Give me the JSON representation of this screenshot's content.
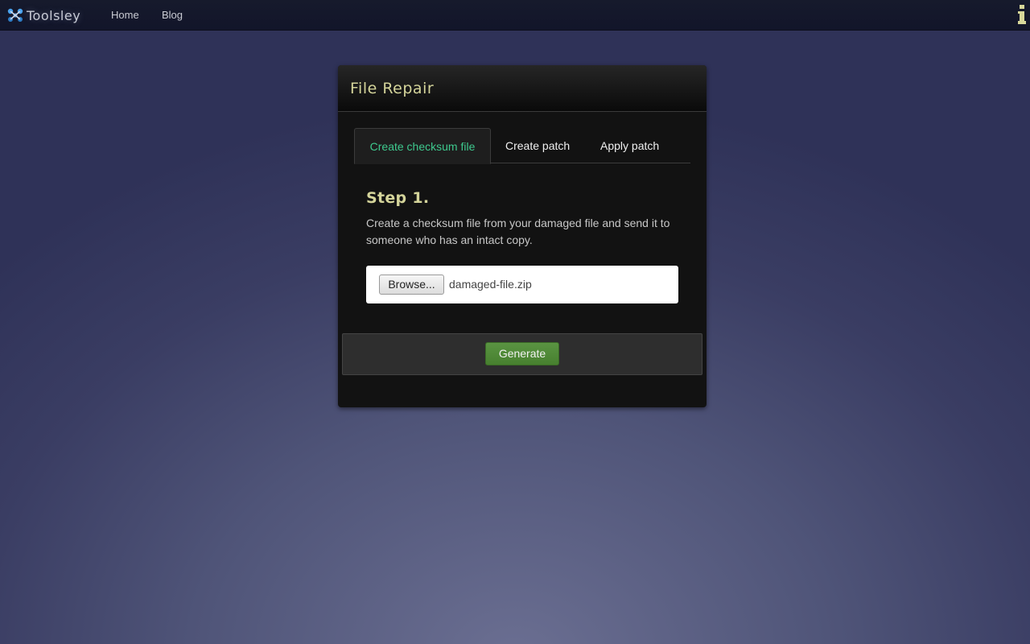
{
  "navbar": {
    "brand": "Toolsley",
    "links": [
      {
        "label": "Home"
      },
      {
        "label": "Blog"
      }
    ],
    "info_icon": "info-icon"
  },
  "panel": {
    "title": "File Repair",
    "tabs": [
      {
        "label": "Create checksum file",
        "active": true
      },
      {
        "label": "Create patch",
        "active": false
      },
      {
        "label": "Apply patch",
        "active": false
      }
    ],
    "step": {
      "title": "Step 1.",
      "description": "Create a checksum file from your damaged file and send it to someone who has an intact copy."
    },
    "file_input": {
      "button_label": "Browse...",
      "file_name": "damaged-file.zip"
    },
    "action": {
      "label": "Generate"
    }
  },
  "colors": {
    "accent_tab": "#3ec98e",
    "title_yellow": "#d4d49a",
    "generate_green": "#4e8a36",
    "navbar_bg": "#141729"
  }
}
